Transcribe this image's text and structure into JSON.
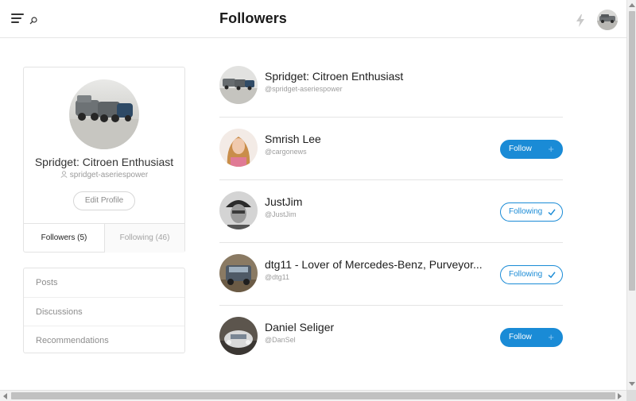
{
  "header": {
    "title": "Followers",
    "menu_icon": "menu-icon",
    "search_icon": "search-icon",
    "activity_icon": "bolt-icon",
    "avatar": "header-avatar"
  },
  "profile": {
    "name": "Spridget: Citroen Enthusiast",
    "handle": "spridget-aseriespower",
    "edit_label": "Edit Profile",
    "tabs": [
      {
        "label": "Followers (5)",
        "active": true
      },
      {
        "label": "Following (46)",
        "active": false
      }
    ]
  },
  "nav": {
    "items": [
      {
        "label": "Posts"
      },
      {
        "label": "Discussions"
      },
      {
        "label": "Recommendations"
      }
    ]
  },
  "followers": [
    {
      "name": "Spridget: Citroen Enthusiast",
      "handle": "@spridget-aseriespower",
      "button": null
    },
    {
      "name": "Smrish Lee",
      "handle": "@cargonews",
      "button": {
        "state": "follow",
        "label": "Follow"
      }
    },
    {
      "name": "JustJim",
      "handle": "@JustJim",
      "button": {
        "state": "following",
        "label": "Following"
      }
    },
    {
      "name": "dtg11 - Lover of Mercedes-Benz, Purveyor...",
      "handle": "@dtg11",
      "button": {
        "state": "following",
        "label": "Following"
      }
    },
    {
      "name": "Daniel Seliger",
      "handle": "@DanSel",
      "button": {
        "state": "follow",
        "label": "Follow"
      }
    }
  ],
  "colors": {
    "accent": "#1a8bd6",
    "border": "#e3e3e3",
    "muted_text": "#9d9d9d"
  }
}
